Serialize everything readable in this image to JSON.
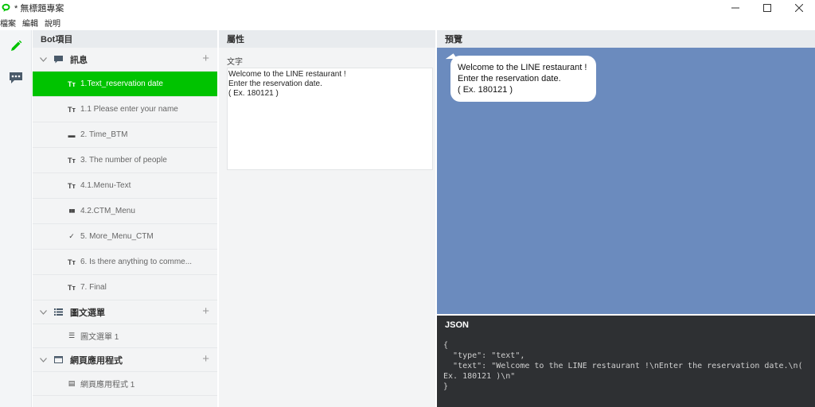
{
  "window": {
    "title": "* 無標題專案",
    "controls": [
      "minimize-icon",
      "maximize-icon",
      "close-icon"
    ]
  },
  "menubar": {
    "items": [
      "檔案",
      "編輯",
      "說明"
    ]
  },
  "rail": {
    "items": [
      {
        "icon": "pencil-icon",
        "color": "#00c300",
        "active": true
      },
      {
        "icon": "chat-bubble-icon",
        "color": "#4a5a6a",
        "active": false
      }
    ]
  },
  "bot_panel": {
    "title": "Bot項目",
    "categories": [
      {
        "label": "訊息",
        "icon": "message-icon",
        "items": [
          {
            "icon": "text-icon",
            "glyph": "Tт",
            "label": "1.Text_reservation date",
            "active": true
          },
          {
            "icon": "text-icon",
            "glyph": "Tт",
            "label": "1.1 Please enter your name"
          },
          {
            "icon": "button-template-icon",
            "glyph": "▬",
            "label": "2. Time_BTM"
          },
          {
            "icon": "text-icon",
            "glyph": "Tт",
            "label": "3. The number of people"
          },
          {
            "icon": "text-icon",
            "glyph": "Tт",
            "label": "4.1.Menu-Text"
          },
          {
            "icon": "carousel-icon",
            "glyph": "▮▮▮",
            "label": "4.2.CTM_Menu"
          },
          {
            "icon": "confirm-icon",
            "glyph": "✓",
            "label": "5. More_Menu_CTM"
          },
          {
            "icon": "text-icon",
            "glyph": "Tт",
            "label": "6. Is there anything to comme..."
          },
          {
            "icon": "text-icon",
            "glyph": "Tт",
            "label": "7. Final"
          }
        ]
      },
      {
        "label": "圖文選單",
        "icon": "rich-menu-icon",
        "items": [
          {
            "icon": "rich-menu-item-icon",
            "glyph": "☰",
            "label": "圖文選單 1"
          }
        ]
      },
      {
        "label": "網頁應用程式",
        "icon": "web-app-icon",
        "items": [
          {
            "icon": "liff-icon",
            "glyph": "▤",
            "label": "網頁應用程式 1"
          }
        ]
      }
    ]
  },
  "attr_panel": {
    "title": "屬性",
    "field_label": "文字",
    "field_value": "Welcome to the LINE restaurant !\nEnter the reservation date.\n( Ex. 180121 )"
  },
  "preview_panel": {
    "title": "預覽",
    "bubble_text": "Welcome to the LINE restaurant !\nEnter the reservation date.\n( Ex. 180121 )",
    "background": "#6b8bbe"
  },
  "json_panel": {
    "title": "JSON",
    "code": "{\n  \"type\": \"text\",\n  \"text\": \"Welcome to the LINE restaurant !\\nEnter the reservation date.\\n( Ex. 180121 )\\n\"\n}"
  },
  "colors": {
    "accent": "#00c300",
    "panel_header": "#e8ebee",
    "json_bg": "#2e3033"
  }
}
